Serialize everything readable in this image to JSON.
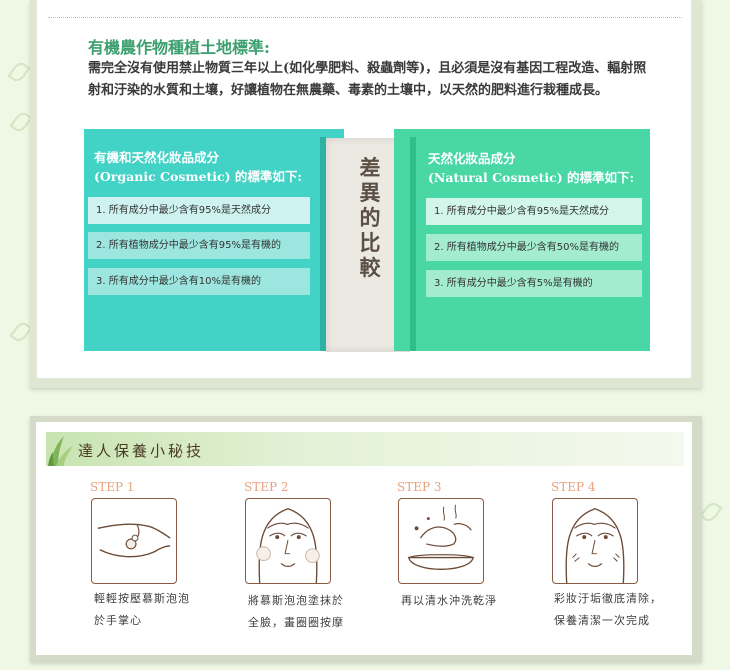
{
  "section": {
    "title": "有機農作物種植土地標準:",
    "description": "需完全沒有使用禁止物質三年以上(如化學肥料、殺蟲劑等)，且必須是沒有基因工程改造、輻射照射和汙染的水質和土壤，好讓植物在無農藥、毒素的土壤中，以天然的肥料進行栽種成長。"
  },
  "compare": {
    "middle_title": "差異的比較",
    "left": {
      "title_line1": "有機和天然化妝品成分",
      "title_line2": "(Organic Cosmetic) 的標準如下:",
      "items": [
        "1. 所有成分中最少含有95%是天然成分",
        "2. 所有植物成分中最少含有95%是有機的",
        "3. 所有成分中最少含有10%是有機的"
      ]
    },
    "right": {
      "title_line1": "天然化妝品成分",
      "title_line2": "(Natural Cosmetic) 的標準如下:",
      "items": [
        "1. 所有成分中最少含有95%是天然成分",
        "2. 所有植物成分中最少含有50%是有機的",
        "3. 所有成分中最少含有5%是有機的"
      ]
    }
  },
  "tips": {
    "title": "達人保養小秘技",
    "steps": [
      {
        "label": "STEP 1",
        "icon": "hand-foam-icon",
        "caption_line1": "輕輕按壓慕斯泡泡",
        "caption_line2": "於手掌心"
      },
      {
        "label": "STEP 2",
        "icon": "face-foam-icon",
        "caption_line1": "將慕斯泡泡塗抹於",
        "caption_line2": "全臉，畫圈圈按摩"
      },
      {
        "label": "STEP 3",
        "icon": "rinse-water-icon",
        "caption_line1": "再以清水沖洗乾淨",
        "caption_line2": ""
      },
      {
        "label": "STEP 4",
        "icon": "clean-face-icon",
        "caption_line1": "彩妝汙垢徹底清除，",
        "caption_line2": "保養清潔一次完成"
      }
    ]
  },
  "colors": {
    "title_green": "#3c9f6e",
    "panel_teal": "#43d2c6",
    "panel_green": "#48d7a5",
    "step_orange": "#e8a27e"
  }
}
